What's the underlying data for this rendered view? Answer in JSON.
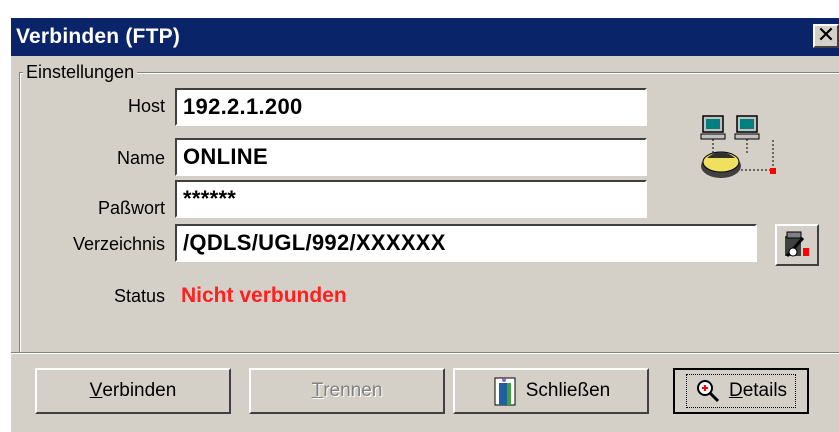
{
  "window": {
    "title": "Verbinden (FTP)",
    "close_glyph": "✕"
  },
  "group": {
    "legend": "Einstellungen"
  },
  "fields": {
    "host": {
      "label": "Host",
      "value": "192.2.1.200"
    },
    "name": {
      "label": "Name",
      "value": "ONLINE"
    },
    "password": {
      "label": "Paßwort",
      "value": "******"
    },
    "directory": {
      "label": "Verzeichnis",
      "value": "/QDLS/UGL/992/XXXXXX"
    }
  },
  "status": {
    "label": "Status",
    "value": "Nicht verbunden",
    "color": "#ff2020"
  },
  "buttons": {
    "connect": {
      "accel": "V",
      "rest": "erbinden"
    },
    "disconnect": {
      "accel": "T",
      "rest": "rennen"
    },
    "close": {
      "label": "Schließen"
    },
    "details": {
      "accel": "D",
      "rest": "etails"
    }
  },
  "icons": {
    "network": "network-computers-icon",
    "browse": "folder-tool-icon",
    "close": "door-exit-icon",
    "details": "magnifier-icon"
  },
  "colors": {
    "titlebar": "#0a246a",
    "face": "#d4d0c8",
    "status": "#ff2020"
  }
}
